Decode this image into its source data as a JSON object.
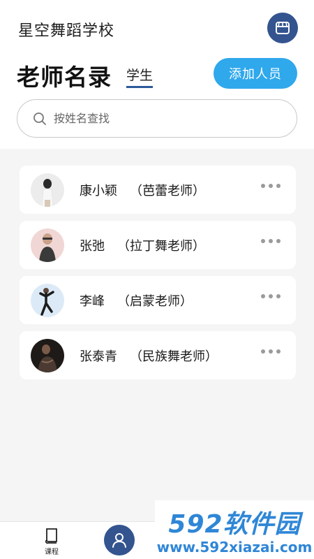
{
  "header": {
    "school_name": "星空舞蹈学校",
    "store_icon": "store-icon"
  },
  "title_row": {
    "title": "老师名录",
    "students_tab": "学生",
    "add_button": "添加人员"
  },
  "search": {
    "placeholder": "按姓名查找",
    "value": ""
  },
  "teachers": [
    {
      "name": "康小颖",
      "role": "（芭蕾老师）"
    },
    {
      "name": "张弛",
      "role": "（拉丁舞老师）"
    },
    {
      "name": "李峰",
      "role": "（启蒙老师）"
    },
    {
      "name": "张泰青",
      "role": "（民族舞老师）"
    }
  ],
  "bottom_nav": {
    "courses_label": "课程"
  },
  "watermark": {
    "brand": "592软件园",
    "url": "www.592xiazai.com"
  },
  "colors": {
    "primary_dark": "#33548f",
    "accent_blue": "#2fa8ec",
    "background_gray": "#f5f5f5"
  }
}
